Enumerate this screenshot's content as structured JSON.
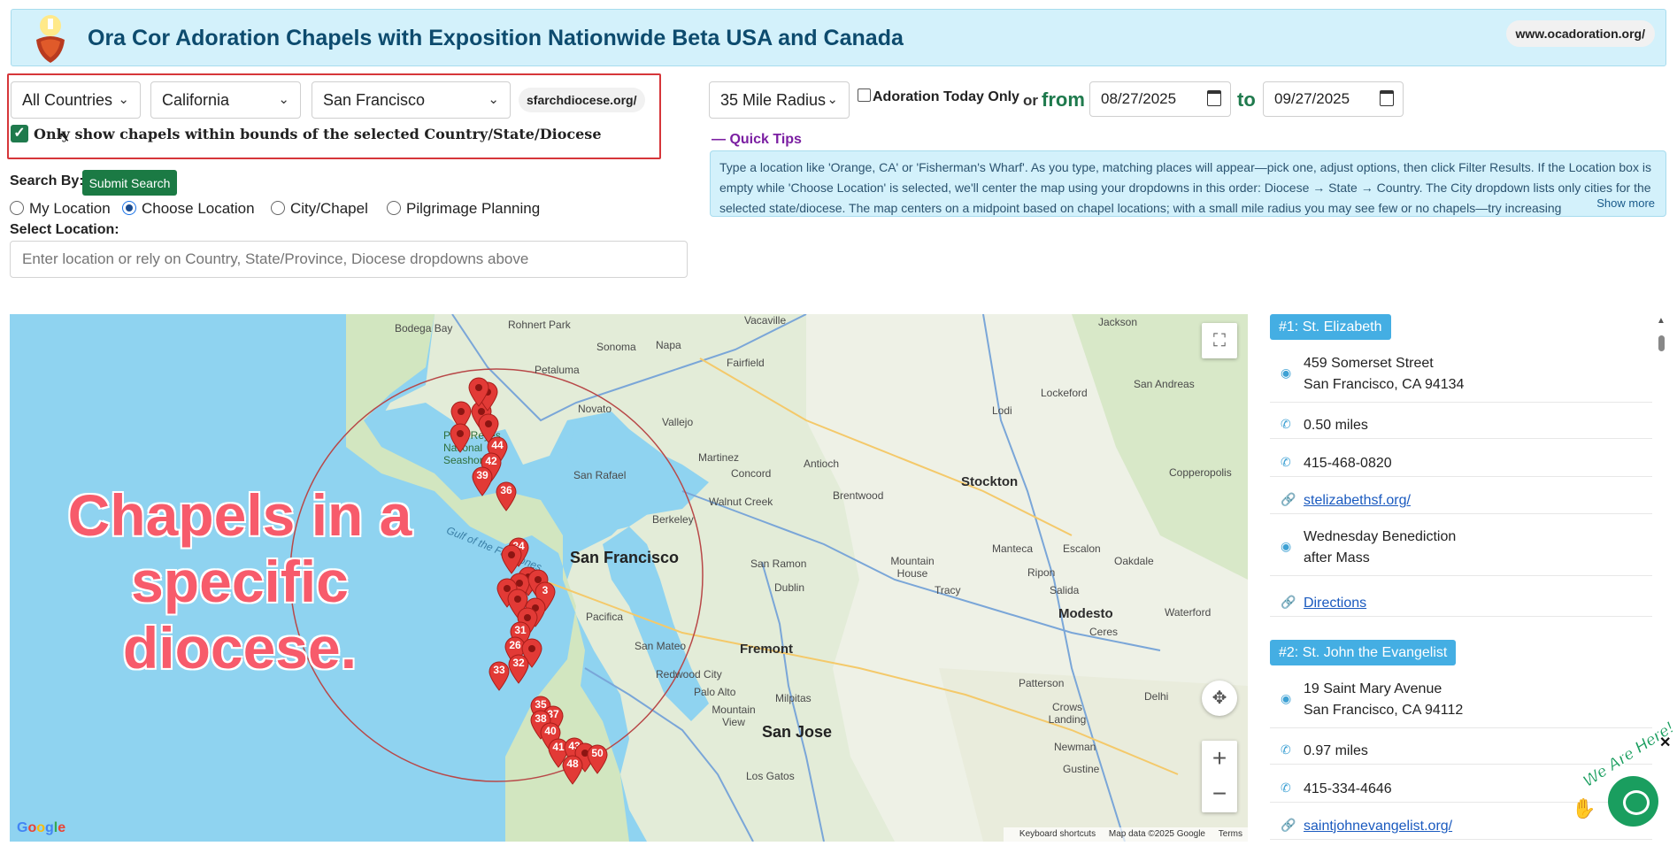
{
  "header": {
    "title": "Ora Cor Adoration Chapels with Exposition Nationwide Beta USA and Canada",
    "site": "www.ocadoration.org/",
    "logo_icon": "sacred-heart-icon"
  },
  "filters": {
    "country": "All Countries",
    "state": "California",
    "diocese": "San Francisco",
    "diocese_site": "sfarchdiocese.org/",
    "bounds_checkbox_label": "Only show chapels within bounds of the selected Country/State/Diocese",
    "bounds_checked": true,
    "radius": "35 Mile Radius",
    "adoration_today_label": "Adoration Today Only",
    "or_label": "or",
    "from_label": "from",
    "to_label": "to",
    "date_from": "08/27/2025",
    "date_to": "09/27/2025"
  },
  "search": {
    "search_by_label": "Search By:",
    "submit_label": "Submit Search",
    "options": [
      "My Location",
      "Choose Location",
      "City/Chapel",
      "Pilgrimage Planning"
    ],
    "selected": "Choose Location",
    "select_location_label": "Select Location:",
    "location_placeholder": "Enter location or rely on Country, State/Province, Diocese dropdowns above"
  },
  "tips": {
    "label": "— Quick Tips",
    "text": "Type a location like 'Orange, CA' or 'Fisherman's Wharf'. As you type, matching places will appear—pick one, adjust options, then click Filter Results. If the Location box is empty while 'Choose Location' is selected, we'll center the map using your dropdowns in this order: Diocese → State → Country. The City dropdown lists only cities for the selected state/diocese. The map centers on a midpoint based on chapel locations; with a small mile radius you may see few or no chapels—try increasing",
    "show_more": "Show more"
  },
  "map": {
    "overlay_text": "Chapels in a specific diocese.",
    "labels": {
      "bodega_bay": "Bodega Bay",
      "rohnert_park": "Rohnert Park",
      "sonoma": "Sonoma",
      "napa": "Napa",
      "vacaville": "Vacaville",
      "jackson": "Jackson",
      "fairfield": "Fairfield",
      "petaluma": "Petaluma",
      "lodi": "Lodi",
      "lockeford": "Lockeford",
      "san_andreas": "San Andreas",
      "vallejo": "Vallejo",
      "point_reyes": "Point Reyes National Seashore",
      "novato": "Novato",
      "martinez": "Martinez",
      "antioch": "Antioch",
      "concord": "Concord",
      "stockton": "Stockton",
      "copperopolis": "Copperopolis",
      "san_rafael": "San Rafael",
      "walnut_creek": "Walnut Creek",
      "brentwood": "Brentwood",
      "berkeley": "Berkeley",
      "gulf": "Gulf of the Farallones",
      "san_francisco": "San Francisco",
      "san_ramon": "San Ramon",
      "manteca": "Manteca",
      "escalon": "Escalon",
      "oakdale": "Oakdale",
      "dublin": "Dublin",
      "mountain_house": "Mountain House",
      "tracy": "Tracy",
      "ripon": "Ripon",
      "salida": "Salida",
      "modesto": "Modesto",
      "waterford": "Waterford",
      "ceres": "Ceres",
      "fremont": "Fremont",
      "san_mateo": "San Mateo",
      "pacifica": "Pacifica",
      "redwood_city": "Redwood City",
      "palo_alto": "Palo Alto",
      "patterson": "Patterson",
      "mountain_view": "Mountain View",
      "milpitas": "Milpitas",
      "delhi": "Delhi",
      "san_jose": "San Jose",
      "crows_landing": "Crows Landing",
      "newman": "Newman",
      "los_gatos": "Los Gatos",
      "gustine": "Gustine"
    },
    "pins": [
      "44",
      "42",
      "39",
      "36",
      "34",
      "3",
      "31",
      "26",
      "32",
      "33",
      "35",
      "37",
      "38",
      "40",
      "41",
      "43",
      "48",
      "50"
    ],
    "google_logo": "Google",
    "attribution": [
      "Keyboard shortcuts",
      "Map data ©2025 Google",
      "Terms"
    ]
  },
  "results": [
    {
      "title": "#1: St. Elizabeth",
      "address_line1": "459 Somerset Street",
      "address_line2": "San Francisco, CA 94134",
      "distance": "0.50 miles",
      "phone": "415-468-0820",
      "website": "stelizabethsf.org/",
      "note_line1": "Wednesday Benediction",
      "note_line2": "after Mass",
      "directions": "Directions"
    },
    {
      "title": "#2: St. John the Evangelist",
      "address_line1": "19 Saint Mary Avenue",
      "address_line2": "San Francisco, CA 94112",
      "distance": "0.97 miles",
      "phone": "415-334-4646",
      "website": "saintjohnevangelist.org/"
    }
  ],
  "chat": {
    "badge": "We Are Here!",
    "close": "✕"
  }
}
